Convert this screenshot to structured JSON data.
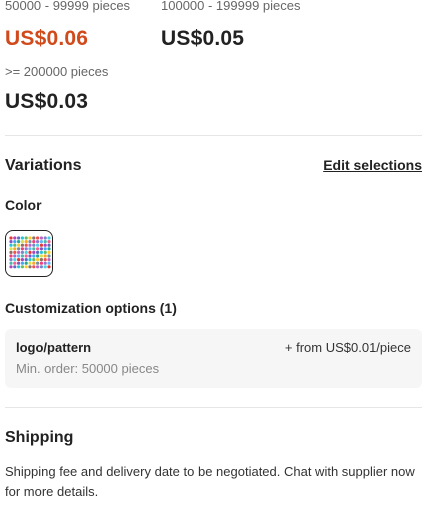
{
  "price_tiers": [
    {
      "range": "50000 - 99999 pieces",
      "price": "US$0.06",
      "active": true
    },
    {
      "range": "100000 - 199999 pieces",
      "price": "US$0.05",
      "active": false
    },
    {
      "range": ">= 200000 pieces",
      "price": "US$0.03",
      "active": false
    }
  ],
  "variations": {
    "title": "Variations",
    "edit_label": "Edit selections",
    "color_label": "Color",
    "swatch_icon": "color-palette-swatch"
  },
  "customization": {
    "title": "Customization options (1)",
    "option_name": "logo/pattern",
    "option_price": "+ from US$0.01/piece",
    "min_order": "Min. order: 50000 pieces"
  },
  "shipping": {
    "title": "Shipping",
    "text": "Shipping fee and delivery date to be negotiated. Chat with supplier now for more details."
  },
  "colors": {
    "active_price": "#d04a1c",
    "text": "#222222",
    "muted": "#888888",
    "box_bg": "#f6f6f6"
  }
}
